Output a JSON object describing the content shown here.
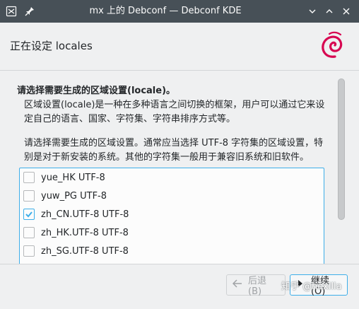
{
  "window": {
    "title": "mx 上的 Debconf — Debconf KDE"
  },
  "header": {
    "title": "正在设定 locales"
  },
  "content": {
    "question": "请选择需要生成的区域设置(locale)。",
    "desc1": "区域设置(locale)是一种在多种语言之间切换的框架，用户可以通过它来设定自己的语言、国家、字符集、字符串排序方式等。",
    "desc2": "请选择需要生成的区域设置。通常应当选择 UTF-8 字符集的区域设置，特别是对于新安装的系统。其他的字符集一般用于兼容旧系统和旧软件。",
    "items": [
      {
        "label": "yue_HK UTF-8",
        "checked": false
      },
      {
        "label": "yuw_PG UTF-8",
        "checked": false
      },
      {
        "label": "zh_CN.UTF-8 UTF-8",
        "checked": true
      },
      {
        "label": "zh_HK.UTF-8 UTF-8",
        "checked": false
      },
      {
        "label": "zh_SG.UTF-8 UTF-8",
        "checked": false
      }
    ]
  },
  "buttons": {
    "back": "后退(B)",
    "next": "继续(O)"
  },
  "watermark": "知乎 @hexilla",
  "colors": {
    "titlebar": "#475057",
    "accent": "#3daee9",
    "debian": "#d70751"
  }
}
